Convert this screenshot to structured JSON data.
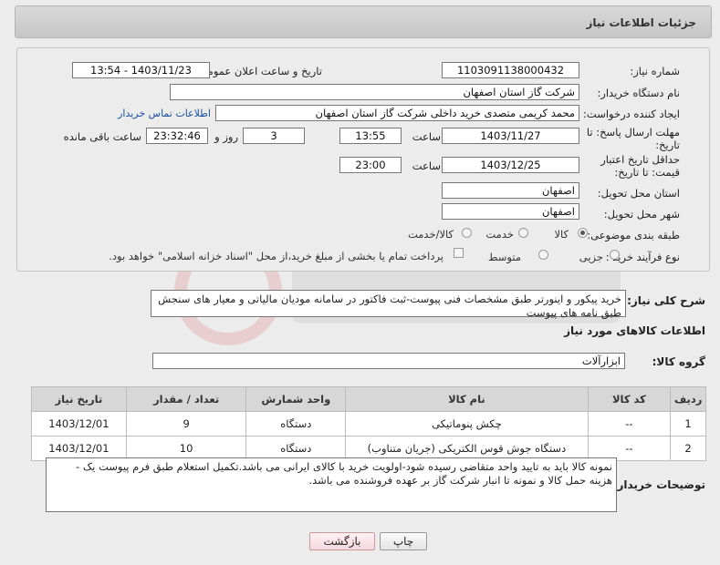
{
  "header": {
    "title": "جزئیات اطلاعات نیاز"
  },
  "form": {
    "need_number_label": "شماره نیاز:",
    "need_number": "1103091138000432",
    "announce_label": "تاریخ و ساعت اعلان عمومی:",
    "announce_value": "1403/11/23 - 13:54",
    "buyer_org_label": "نام دستگاه خریدار:",
    "buyer_org": "شرکت گاز استان اصفهان",
    "creator_label": "ایجاد کننده درخواست:",
    "creator": "محمد کریمی متصدی خرید داخلی شرکت گاز استان اصفهان",
    "contact_link": "اطلاعات تماس خریدار",
    "reply_deadline_label": "مهلت ارسال پاسخ: تا تاریخ:",
    "reply_date": "1403/11/27",
    "time_label": "ساعت",
    "reply_time": "13:55",
    "days_value": "3",
    "days_label": "روز و",
    "remaining_time": "23:32:46",
    "remaining_label": "ساعت باقی مانده",
    "price_validity_label": "حداقل تاریخ اعتبار قیمت: تا تاریخ:",
    "price_date": "1403/12/25",
    "price_time": "23:00",
    "province_label": "استان محل تحویل:",
    "province": "اصفهان",
    "city_label": "شهر محل تحویل:",
    "city": "اصفهان",
    "category_label": "طبقه بندی موضوعی:",
    "category_options": [
      "کالا",
      "خدمت",
      "کالا/خدمت"
    ],
    "process_label": "نوع فرآیند خرید :",
    "process_options": [
      "جزیی",
      "متوسط"
    ],
    "payment_note": "پرداخت تمام یا بخشی از مبلغ خرید،از محل \"اسناد خزانه اسلامی\" خواهد بود."
  },
  "description": {
    "label": "شرح کلی نیاز:",
    "text": "خرید پیکور و اینورتر طبق مشخصات فنی پیوست-ثبت فاکتور در سامانه مودیان مالیاتی و معیار های سنجش طبق نامه های پیوست"
  },
  "goods": {
    "section_title": "اطلاعات کالاهای مورد نیاز",
    "group_label": "گروه کالا:",
    "group_value": "ابزارآلات",
    "columns": [
      "ردیف",
      "کد کالا",
      "نام کالا",
      "واحد شمارش",
      "تعداد / مقدار",
      "تاریخ نیاز"
    ],
    "rows": [
      [
        "1",
        "--",
        "چکش پنوماتیکی",
        "دستگاه",
        "9",
        "1403/12/01"
      ],
      [
        "2",
        "--",
        "دستگاه جوش قوس الکتریکی (جریان متناوب)",
        "دستگاه",
        "10",
        "1403/12/01"
      ]
    ]
  },
  "buyer_notes": {
    "label": "توضیحات خریدار:",
    "text": "نمونه کالا باید به تایید واحد متقاضی رسیده شود-اولویت خرید با کالای ایرانی می باشد.تکمیل استعلام طبق فرم پیوست یک - هزینه حمل کالا و نمونه تا انبار شرکت گاز بر عهده فروشنده می باشد."
  },
  "buttons": {
    "print": "چاپ",
    "back": "بازگشت"
  },
  "colors": {
    "link": "#1a4fa0",
    "header_bg": "#cfcfcf",
    "back_button": "#f6d8df"
  }
}
